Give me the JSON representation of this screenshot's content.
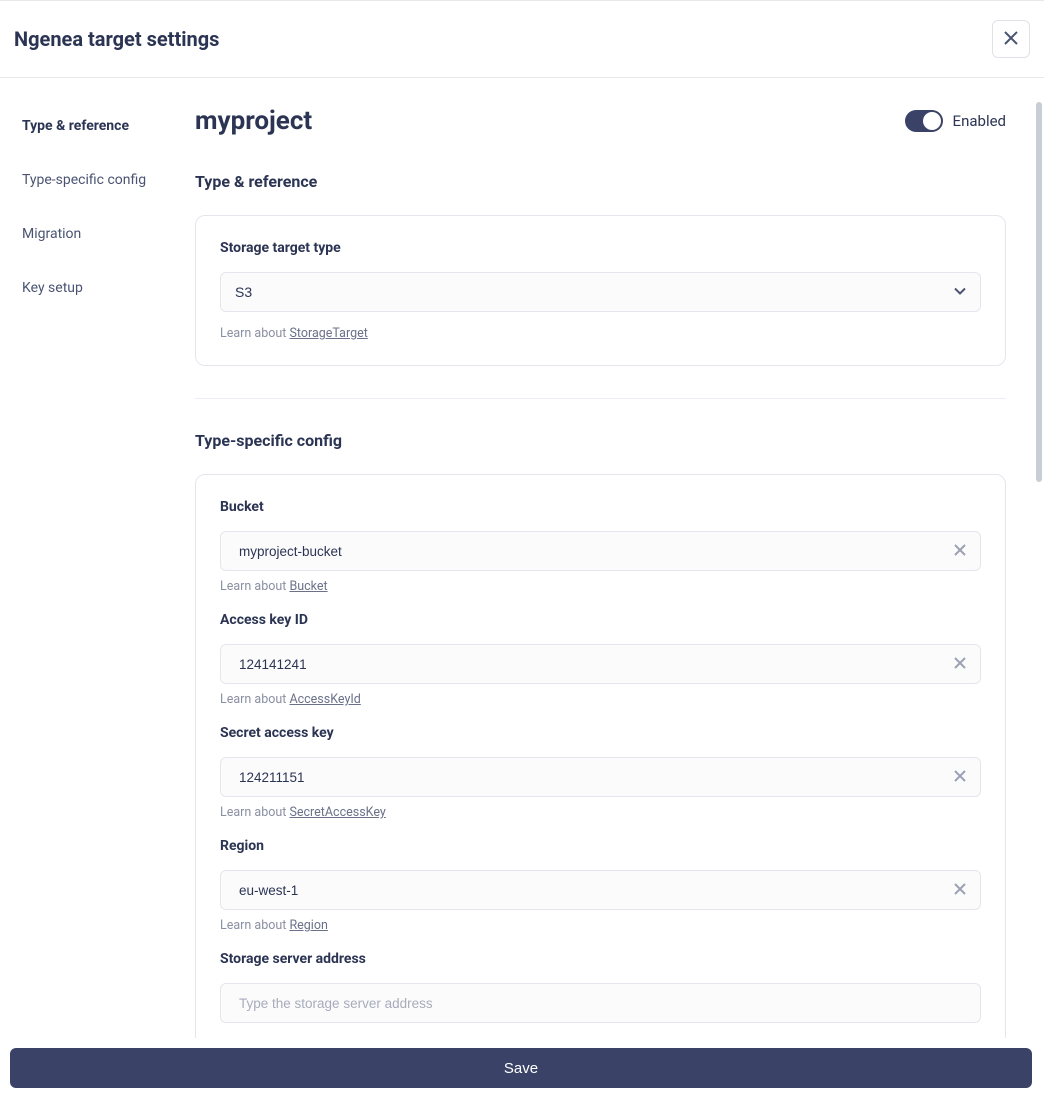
{
  "header": {
    "title": "Ngenea target settings"
  },
  "sidebar": {
    "items": [
      {
        "label": "Type & reference",
        "active": true
      },
      {
        "label": "Type-specific config",
        "active": false
      },
      {
        "label": "Migration",
        "active": false
      },
      {
        "label": "Key setup",
        "active": false
      }
    ]
  },
  "main": {
    "project_title": "myproject",
    "enabled_label": "Enabled",
    "sections": {
      "type_reference": {
        "heading": "Type & reference",
        "storage_type_label": "Storage target type",
        "storage_type_value": "S3",
        "help_prefix": "Learn about ",
        "help_link": "StorageTarget"
      },
      "type_specific": {
        "heading": "Type-specific config",
        "fields": {
          "bucket": {
            "label": "Bucket",
            "value": "myproject-bucket",
            "help_prefix": "Learn about ",
            "help_link": "Bucket"
          },
          "access_key": {
            "label": "Access key ID",
            "value": "124141241",
            "help_prefix": "Learn about ",
            "help_link": "AccessKeyId"
          },
          "secret_key": {
            "label": "Secret access key",
            "value": "124211151",
            "help_prefix": "Learn about ",
            "help_link": "SecretAccessKey"
          },
          "region": {
            "label": "Region",
            "value": "eu-west-1",
            "help_prefix": "Learn about ",
            "help_link": "Region"
          },
          "server": {
            "label": "Storage server address",
            "value": "",
            "placeholder": "Type the storage server address"
          }
        }
      }
    }
  },
  "footer": {
    "save_label": "Save"
  }
}
